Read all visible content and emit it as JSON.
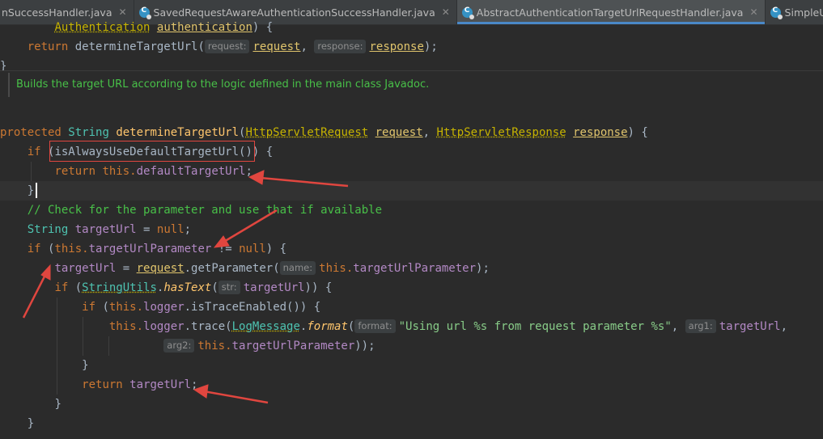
{
  "tabs": [
    {
      "label": "nSuccessHandler.java",
      "active": false
    },
    {
      "label": "SavedRequestAwareAuthenticationSuccessHandler.java",
      "active": false
    },
    {
      "label": "AbstractAuthenticationTargetUrlRequestHandler.java",
      "active": true
    },
    {
      "label": "SimpleUrlAuthenticatio",
      "active": false
    }
  ],
  "close_glyph": "✕",
  "javadoc": "Builds the target URL according to the logic defined in the main class Javadoc.",
  "code": {
    "l1_type": "Authentication",
    "l1_param": "authentication",
    "l1_end": ") {",
    "l2_kw": "return",
    "l2_call": "determineTargetUrl(",
    "l2_hint1": "request:",
    "l2_arg1": "request",
    "l2_sep": ",",
    "l2_hint2": "response:",
    "l2_arg2": "response",
    "l2_end": ");",
    "l3": "}",
    "m_mod": "protected",
    "m_ret": "String",
    "m_name": "determineTargetUrl",
    "m_open": "(",
    "m_t1": "HttpServletRequest",
    "m_p1": "request",
    "m_sep": ",",
    "m_t2": "HttpServletResponse",
    "m_p2": "response",
    "m_end": ") {",
    "if1_kw": "if",
    "if1_cond": "(isAlwaysUseDefaultTargetUrl())",
    "if1_end": "{",
    "ret1_kw": "return",
    "ret1_this": "this.",
    "ret1_fld": "defaultTargetUrl",
    "ret1_end": ";",
    "close1": "}",
    "comment": "// Check for the parameter and use that if available",
    "decl_type": "String",
    "decl_var": "targetUrl",
    "decl_eq": "=",
    "decl_null": "null",
    "decl_end": ";",
    "if2_kw": "if",
    "if2_open": "(",
    "if2_this": "this.",
    "if2_fld": "targetUrlParameter",
    "if2_ne": "!=",
    "if2_null": "null",
    "if2_end": ") {",
    "asg_var": "targetUrl",
    "asg_eq": "=",
    "asg_req": "request",
    "asg_call": ".getParameter(",
    "asg_hint": "name:",
    "asg_this": "this.",
    "asg_fld": "targetUrlParameter",
    "asg_end": ");",
    "if3_kw": "if",
    "if3_open": "(",
    "if3_cls": "StringUtils",
    "if3_dot": ".",
    "if3_fn": "hasText",
    "if3_po": "(",
    "if3_hint": "str:",
    "if3_arg": "targetUrl",
    "if3_end": ")) {",
    "if4_kw": "if",
    "if4_open": "(",
    "if4_this": "this.",
    "if4_fld": "logger",
    "if4_call": ".isTraceEnabled()) {",
    "tr_this": "this.",
    "tr_fld": "logger",
    "tr_call": ".trace(",
    "tr_cls": "LogMessage",
    "tr_dot": ".",
    "tr_fn": "format",
    "tr_po": "(",
    "tr_hint1": "format:",
    "tr_str": "\"Using url %s from request parameter %s\"",
    "tr_sep": ",",
    "tr_hint2": "arg1:",
    "tr_arg1": "targetUrl",
    "tr_comma": ",",
    "tr2_hint": "arg2:",
    "tr2_this": "this.",
    "tr2_fld": "targetUrlParameter",
    "tr2_end": "));",
    "close2": "}",
    "ret2_kw": "return",
    "ret2_var": "targetUrl",
    "ret2_end": ";",
    "close3": "}",
    "close4": "}"
  },
  "colors": {
    "annotation": "#e0463f",
    "keyword": "#cc7832",
    "comment": "#48c048"
  }
}
